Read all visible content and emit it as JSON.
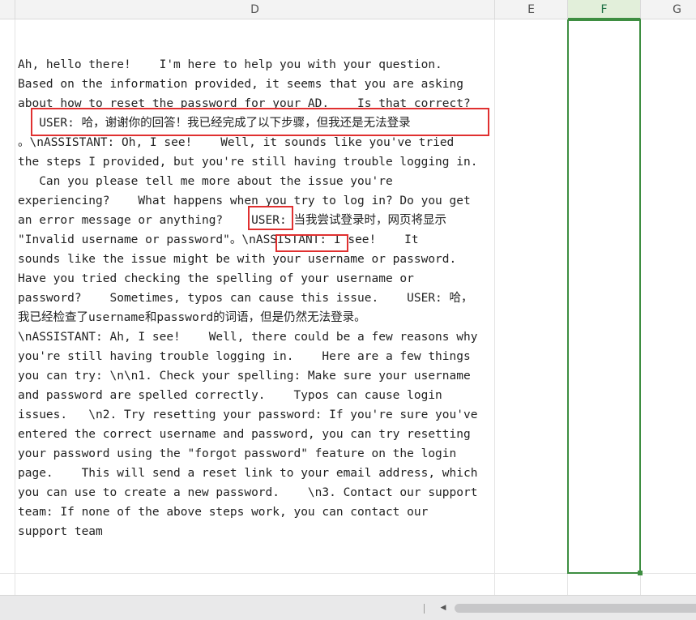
{
  "columns": {
    "d": "D",
    "e": "E",
    "f": "F",
    "g": "G"
  },
  "cell_d_text": "Ah, hello there!    I'm here to help you with your question.\nBased on the information provided, it seems that you are asking\nabout how to reset the password for your AD.    Is that correct?\n   USER: 哈，谢谢你的回答！我已经完成了以下步骤，但我还是无法登录\n。\\nASSISTANT: Oh, I see!    Well, it sounds like you've tried\nthe steps I provided, but you're still having trouble logging in.\n   Can you please tell me more about the issue you're\nexperiencing?    What happens when you try to log in? Do you get\nan error message or anything?    USER: 当我尝试登录时，网页将显示\n\"Invalid username or password\"。\\nASSISTANT: I see!    It\nsounds like the issue might be with your username or password.\nHave you tried checking the spelling of your username or\npassword?    Sometimes, typos can cause this issue.    USER: 哈，\n我已经检查了username和password的词语，但是仍然无法登录。\n\\nASSISTANT: Ah, I see!    Well, there could be a few reasons why\nyou're still having trouble logging in.    Here are a few things\nyou can try: \\n\\n1. Check your spelling: Make sure your username\nand password are spelled correctly.    Typos can cause login\nissues.   \\n2. Try resetting your password: If you're sure you've\nentered the correct username and password, you can try resetting\nyour password using the \"forgot password\" feature on the login\npage.    This will send a reset link to your email address, which\nyou can use to create a new password.    \\n3. Contact our support\nteam: If none of the above steps work, you can contact our\nsupport team",
  "colors": {
    "annotation": "#e03030",
    "selection": "#3e8e41"
  }
}
